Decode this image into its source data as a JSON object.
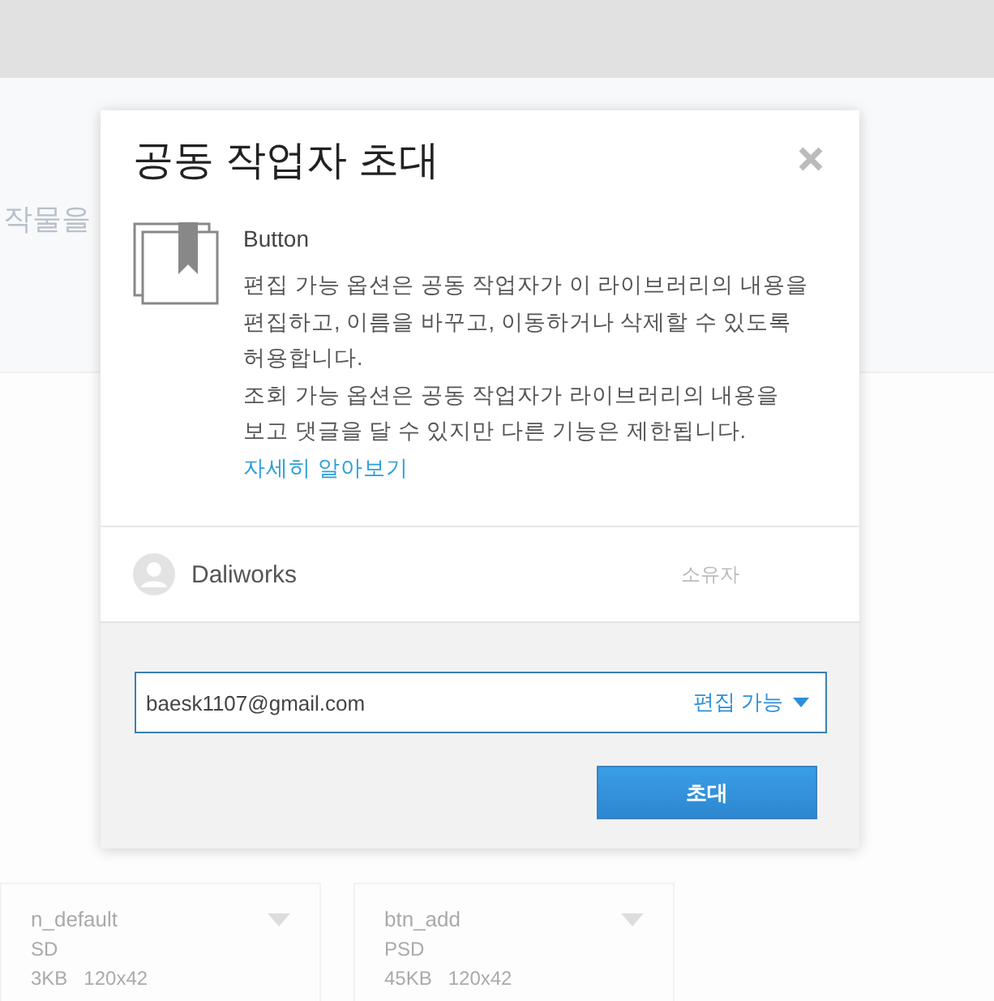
{
  "background": {
    "heading": "작물을",
    "cards": [
      {
        "name": "n_default",
        "type": "SD",
        "meta": "3KB   120x42"
      },
      {
        "name": "btn_add",
        "type": "PSD",
        "meta": "45KB   120x42"
      }
    ]
  },
  "dialog": {
    "title": "공동 작업자 초대",
    "library": {
      "name": "Button",
      "paragraphs": [
        "편집 가능 옵션은 공동 작업자가 이 라이브러리의 내용을 편집하고, 이름을 바꾸고, 이동하거나 삭제할 수 있도록 허용합니다.",
        "조회 가능 옵션은 공동 작업자가 라이브러리의 내용을 보고 댓글을 달 수 있지만 다른 기능은 제한됩니다."
      ],
      "link": "자세히 알아보기"
    },
    "owner": {
      "name": "Daliworks",
      "role": "소유자"
    },
    "invite": {
      "email": "baesk1107@gmail.com",
      "permission": "편집 가능",
      "button": "초대"
    }
  }
}
